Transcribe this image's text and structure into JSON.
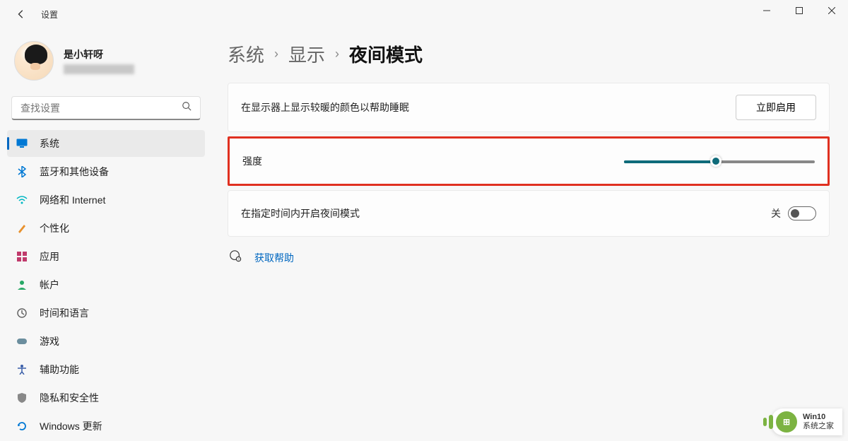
{
  "window": {
    "title": "设置"
  },
  "user": {
    "name": "是小轩呀"
  },
  "search": {
    "placeholder": "查找设置"
  },
  "nav": {
    "items": [
      {
        "label": "系统",
        "icon": "monitor",
        "color": "#0078d4",
        "active": true
      },
      {
        "label": "蓝牙和其他设备",
        "icon": "bluetooth",
        "color": "#0078d4"
      },
      {
        "label": "网络和 Internet",
        "icon": "wifi",
        "color": "#00b7c3"
      },
      {
        "label": "个性化",
        "icon": "brush",
        "color": "#e8912d"
      },
      {
        "label": "应用",
        "icon": "apps",
        "color": "#c03a6b"
      },
      {
        "label": "帐户",
        "icon": "person",
        "color": "#27a866"
      },
      {
        "label": "时间和语言",
        "icon": "clock",
        "color": "#666"
      },
      {
        "label": "游戏",
        "icon": "gamepad",
        "color": "#6b8e9e"
      },
      {
        "label": "辅助功能",
        "icon": "accessibility",
        "color": "#3a5ea8"
      },
      {
        "label": "隐私和安全性",
        "icon": "shield",
        "color": "#888"
      },
      {
        "label": "Windows 更新",
        "icon": "update",
        "color": "#0078d4"
      }
    ]
  },
  "breadcrumb": {
    "items": [
      "系统",
      "显示",
      "夜间模式"
    ]
  },
  "cards": {
    "description": {
      "text": "在显示器上显示较暖的颜色以帮助睡眠",
      "button": "立即启用"
    },
    "strength": {
      "label": "强度",
      "value": 48,
      "highlighted": true
    },
    "schedule": {
      "label": "在指定时间内开启夜间模式",
      "state_label": "关",
      "on": false
    }
  },
  "help": {
    "label": "获取帮助"
  },
  "watermark": {
    "line1": "Win10",
    "line2": "系统之家"
  }
}
